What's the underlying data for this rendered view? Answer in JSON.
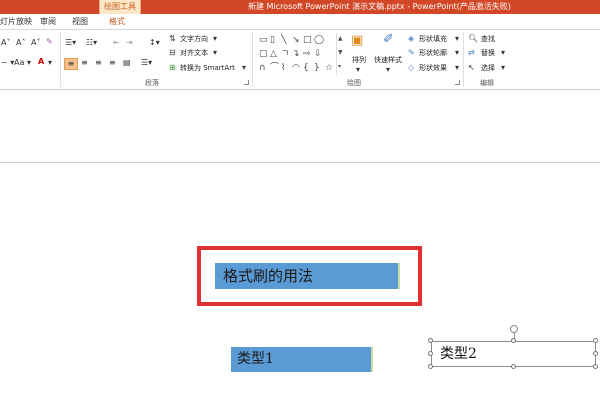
{
  "window": {
    "context_tab": "绘图工具",
    "title": "新建 Microsoft PowerPoint 演示文稿.pptx -  PowerPoint(产品激活失败)"
  },
  "tabs": [
    "灯片放映",
    "审阅",
    "视图",
    "格式"
  ],
  "ribbon": {
    "paragraph": {
      "label": "段落",
      "text_direction": "文字方向",
      "align_text": "对齐文本",
      "convert_smartart": "转换为 SmartArt"
    },
    "drawing": {
      "label": "绘图",
      "arrange": "排列",
      "quick_styles": "快速样式",
      "shape_fill": "形状填充",
      "shape_outline": "形状轮廓",
      "shape_effects": "形状效果"
    },
    "editing": {
      "label": "编辑",
      "find": "查找",
      "replace": "替换",
      "select": "选择"
    },
    "font": {
      "font_size_label": "Aa"
    }
  },
  "slide": {
    "title_text": "格式刷的用法",
    "type1_text": "类型1",
    "type2_text": "类型2"
  },
  "colors": {
    "titlebar": "#d24726",
    "accent_fill": "#5b9bd5",
    "highlight_frame": "#e03232"
  }
}
